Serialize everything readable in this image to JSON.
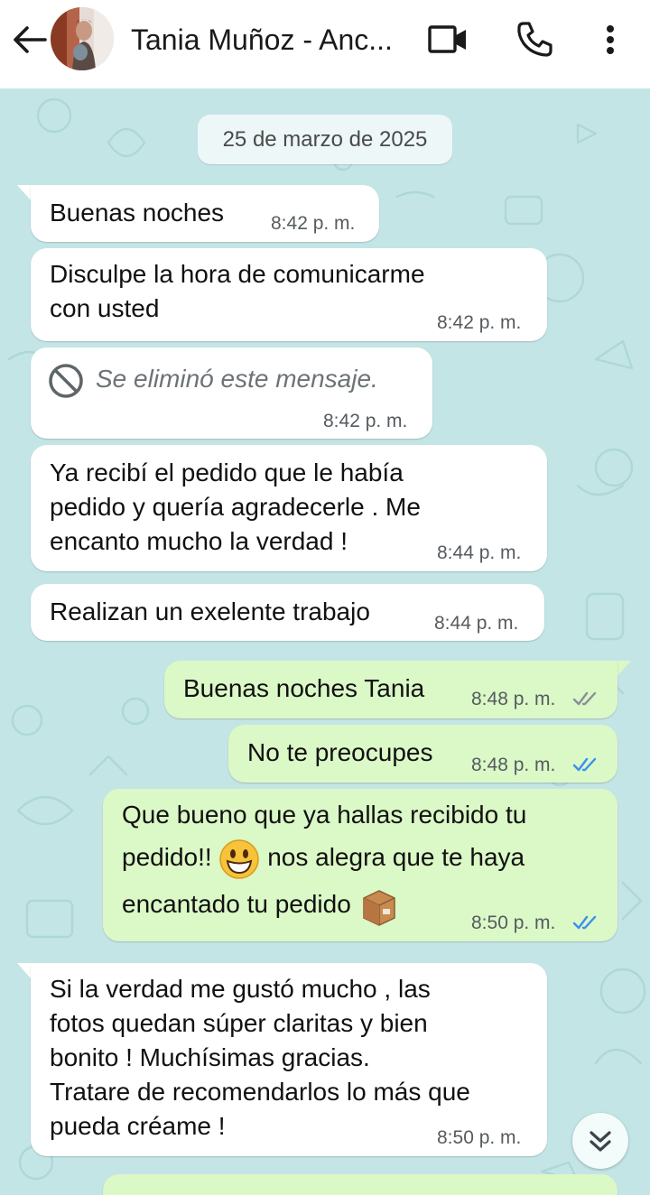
{
  "header": {
    "contact_name": "Tania Muñoz - Anc...",
    "icons": {
      "back": "arrow-left-icon",
      "video": "video-camera-icon",
      "call": "phone-icon",
      "more": "more-vertical-icon"
    }
  },
  "chat": {
    "date_chip": "25 de marzo de 2025",
    "messages": [
      {
        "direction": "in",
        "text": "Buenas noches",
        "time": "8:42 p. m."
      },
      {
        "direction": "in",
        "text": "Disculpe la hora de comunicarme\ncon usted",
        "time": "8:42 p. m."
      },
      {
        "direction": "in",
        "deleted": true,
        "text": "Se eliminó este mensaje.",
        "time": "8:42 p. m."
      },
      {
        "direction": "in",
        "text": "Ya recibí el pedido que le había\npedido y quería agradecerle . Me\nencanto mucho la verdad !",
        "time": "8:44 p. m."
      },
      {
        "direction": "in",
        "text": "Realizan un exelente trabajo",
        "time": "8:44 p. m."
      },
      {
        "direction": "out",
        "text": "Buenas noches Tania",
        "time": "8:48 p. m.",
        "status": "delivered"
      },
      {
        "direction": "out",
        "text": "No te preocupes",
        "time": "8:48 p. m.",
        "status": "read"
      },
      {
        "direction": "out",
        "text_parts": [
          "Que bueno que ya hallas recibido tu",
          "pedido!!",
          "nos alegra que te haya",
          "encantado tu pedido"
        ],
        "emojis": [
          "grinning-face-emoji",
          "package-emoji"
        ],
        "time": "8:50 p. m.",
        "status": "read"
      },
      {
        "direction": "in",
        "text": "Si la verdad me gustó mucho , las\nfotos quedan súper claritas y bien\nbonito ! Muchísimas gracias.\nTratare de recomendarlos lo más que\npueda créame !",
        "time": "8:50 p. m."
      }
    ],
    "scroll_button_icon": "double-chevron-down-icon"
  },
  "colors": {
    "header_bg": "#ffffff",
    "chat_wallpaper": "#c4e5e6",
    "incoming_bubble": "#ffffff",
    "outgoing_bubble": "#dbf8c7",
    "read_tick": "#3b8ff0",
    "delivered_tick": "#8a8f93"
  }
}
